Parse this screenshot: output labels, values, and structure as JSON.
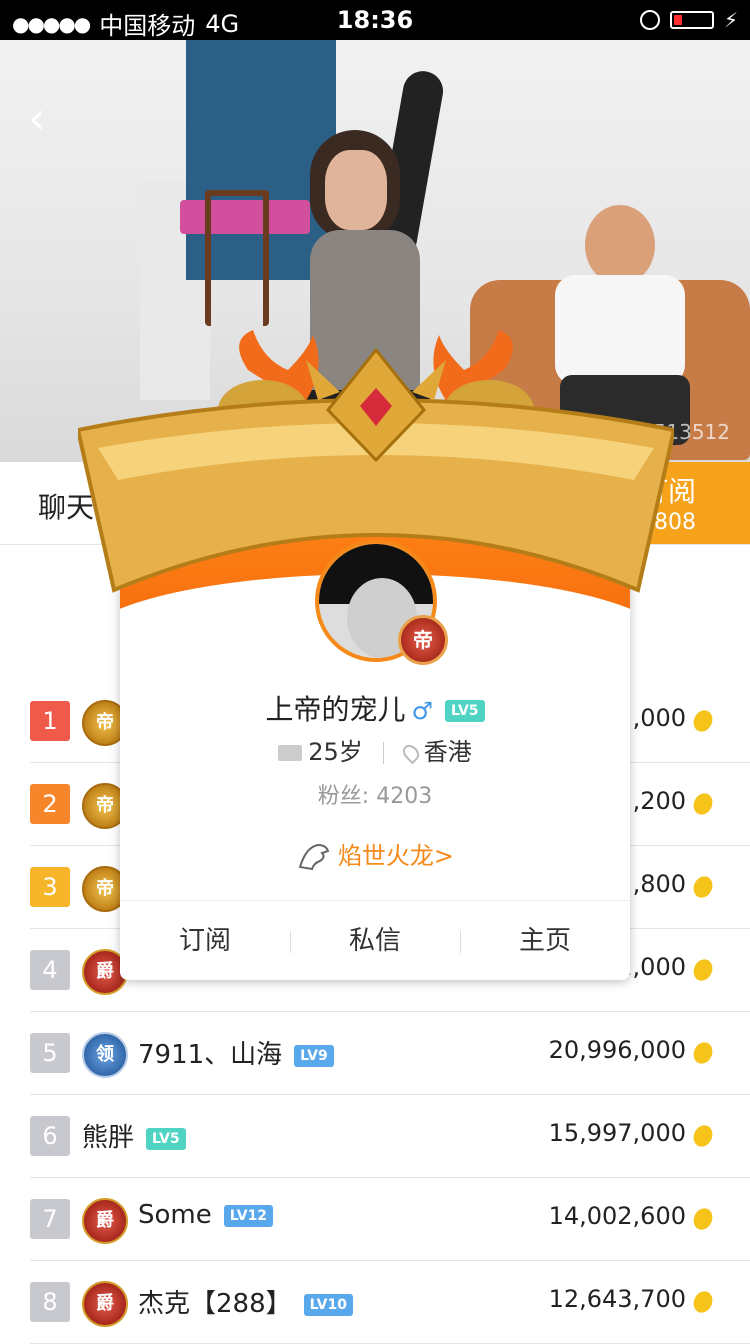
{
  "status_bar": {
    "signal": "●●●●●",
    "carrier": "中国移动",
    "network": "4G",
    "time": "18:36"
  },
  "video": {
    "watermark": "513512"
  },
  "tabs": {
    "chat_label": "聊天",
    "subscribe_label": "订阅",
    "subscribe_count": "9808"
  },
  "ranking": [
    {
      "rank": "1",
      "rank_color": "#f05a4a",
      "badge": "帝",
      "badge_style": "gold",
      "name": "",
      "level": "",
      "score": ",000"
    },
    {
      "rank": "2",
      "rank_color": "#f7862a",
      "badge": "帝",
      "badge_style": "gold",
      "name": "",
      "level": "",
      "score": ",200"
    },
    {
      "rank": "3",
      "rank_color": "#f7b62a",
      "badge": "帝",
      "badge_style": "gold",
      "name": "",
      "level": "",
      "score": ",800"
    },
    {
      "rank": "4",
      "rank_color": "#c8c8cf",
      "badge": "爵",
      "badge_style": "red",
      "name": "",
      "level": "",
      "score": "2,000"
    },
    {
      "rank": "5",
      "rank_color": "#c8c8cf",
      "badge": "领",
      "badge_style": "blue",
      "name": "7911、山海",
      "level": "LV9",
      "level_style": "blue",
      "score": "20,996,000"
    },
    {
      "rank": "6",
      "rank_color": "#c8c8cf",
      "badge": "",
      "badge_style": "",
      "name": "熊胖",
      "level": "LV5",
      "level_style": "green",
      "score": "15,997,000"
    },
    {
      "rank": "7",
      "rank_color": "#c8c8cf",
      "badge": "爵",
      "badge_style": "red",
      "name": "Some",
      "level": "LV12",
      "level_style": "blue",
      "score": "14,002,600"
    },
    {
      "rank": "8",
      "rank_color": "#c8c8cf",
      "badge": "爵",
      "badge_style": "red",
      "name": "杰克【288】",
      "level": "LV10",
      "level_style": "blue",
      "score": "12,643,700"
    }
  ],
  "profile_card": {
    "username": "上帝的宠儿",
    "gender_symbol": "♂",
    "level": "LV5",
    "avatar_badge": "帝",
    "age": "25岁",
    "location": "香港",
    "fans": "粉丝: 4203",
    "title": "焰世火龙>",
    "actions": [
      "订阅",
      "私信",
      "主页"
    ]
  }
}
